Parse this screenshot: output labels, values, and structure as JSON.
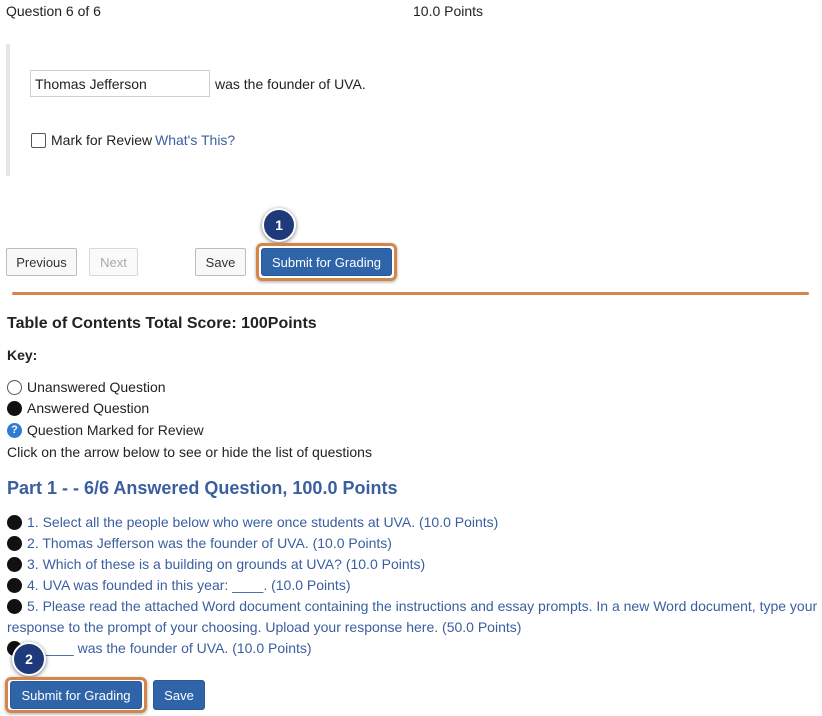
{
  "header": {
    "question_progress": "Question 6 of 6",
    "points": "10.0 Points"
  },
  "question": {
    "answer_value": "Thomas Jefferson",
    "text_after": "was the founder of UVA.",
    "mark_for_review_label": "Mark for Review",
    "whats_this_link": "What's This?"
  },
  "nav_buttons": {
    "previous": "Previous",
    "next": "Next",
    "save": "Save",
    "submit": "Submit for Grading"
  },
  "callouts": {
    "one": "1",
    "two": "2"
  },
  "toc": {
    "title": "Table of Contents Total Score: 100Points",
    "key_label": "Key:",
    "key_items": [
      "Unanswered Question",
      "Answered Question",
      "Question Marked for Review"
    ],
    "instructions": "Click on the arrow below to see or hide the list of questions",
    "part_title": "Part 1 - - 6/6 Answered Question, 100.0 Points",
    "questions": [
      "1. Select all the people below who were once students at UVA. (10.0 Points)",
      "2. Thomas Jefferson was the founder of UVA. (10.0 Points)",
      "3. Which of these is a building on grounds at UVA? (10.0 Points)",
      "4. UVA was founded in this year: ____. (10.0 Points)",
      "5. Please read the attached Word document containing the instructions and essay prompts. In a new Word document, type your",
      "response to the prompt of your choosing. Upload your response here. (50.0 Points)",
      "6. ____ was the founder of UVA. (10.0 Points)"
    ]
  },
  "bottom_buttons": {
    "submit": "Submit for Grading",
    "save": "Save"
  },
  "colors": {
    "accent": "#2f64a9",
    "highlight": "#d4864a",
    "link": "#3a5f9f",
    "badge": "#1f3a7a"
  }
}
